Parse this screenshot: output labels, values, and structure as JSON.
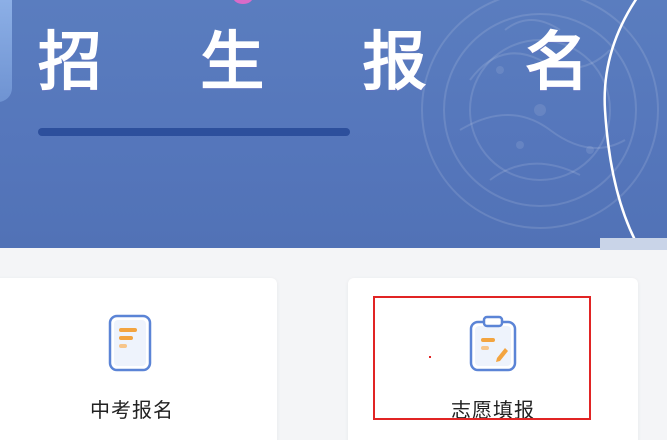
{
  "banner": {
    "title": "招 生 报 名"
  },
  "cards": [
    {
      "label": "中考报名",
      "icon": "document-icon"
    },
    {
      "label": "志愿填报",
      "icon": "clipboard-edit-icon"
    }
  ],
  "colors": {
    "banner": "#5576bb",
    "underline": "#2d4f9c",
    "icon_stroke": "#5b84d6",
    "icon_accent": "#f3a440",
    "highlight": "#e12424"
  }
}
